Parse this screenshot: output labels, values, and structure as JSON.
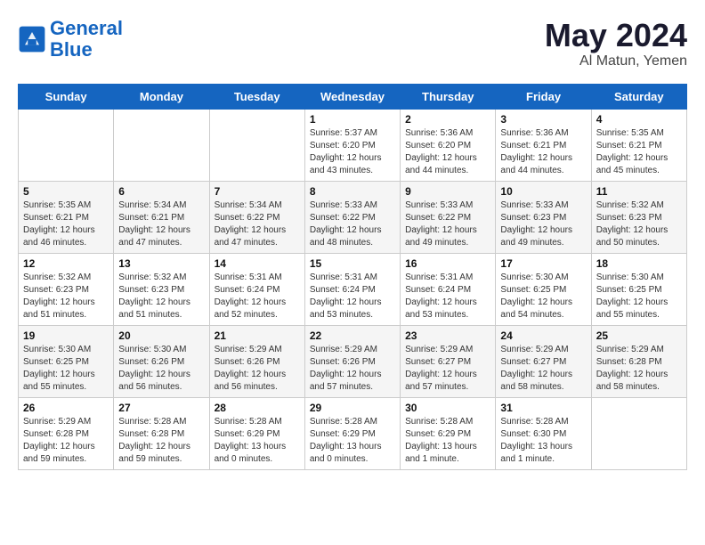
{
  "logo": {
    "line1": "General",
    "line2": "Blue"
  },
  "title": "May 2024",
  "location": "Al Matun, Yemen",
  "days_header": [
    "Sunday",
    "Monday",
    "Tuesday",
    "Wednesday",
    "Thursday",
    "Friday",
    "Saturday"
  ],
  "weeks": [
    [
      {
        "day": "",
        "info": ""
      },
      {
        "day": "",
        "info": ""
      },
      {
        "day": "",
        "info": ""
      },
      {
        "day": "1",
        "info": "Sunrise: 5:37 AM\nSunset: 6:20 PM\nDaylight: 12 hours\nand 43 minutes."
      },
      {
        "day": "2",
        "info": "Sunrise: 5:36 AM\nSunset: 6:20 PM\nDaylight: 12 hours\nand 44 minutes."
      },
      {
        "day": "3",
        "info": "Sunrise: 5:36 AM\nSunset: 6:21 PM\nDaylight: 12 hours\nand 44 minutes."
      },
      {
        "day": "4",
        "info": "Sunrise: 5:35 AM\nSunset: 6:21 PM\nDaylight: 12 hours\nand 45 minutes."
      }
    ],
    [
      {
        "day": "5",
        "info": "Sunrise: 5:35 AM\nSunset: 6:21 PM\nDaylight: 12 hours\nand 46 minutes."
      },
      {
        "day": "6",
        "info": "Sunrise: 5:34 AM\nSunset: 6:21 PM\nDaylight: 12 hours\nand 47 minutes."
      },
      {
        "day": "7",
        "info": "Sunrise: 5:34 AM\nSunset: 6:22 PM\nDaylight: 12 hours\nand 47 minutes."
      },
      {
        "day": "8",
        "info": "Sunrise: 5:33 AM\nSunset: 6:22 PM\nDaylight: 12 hours\nand 48 minutes."
      },
      {
        "day": "9",
        "info": "Sunrise: 5:33 AM\nSunset: 6:22 PM\nDaylight: 12 hours\nand 49 minutes."
      },
      {
        "day": "10",
        "info": "Sunrise: 5:33 AM\nSunset: 6:23 PM\nDaylight: 12 hours\nand 49 minutes."
      },
      {
        "day": "11",
        "info": "Sunrise: 5:32 AM\nSunset: 6:23 PM\nDaylight: 12 hours\nand 50 minutes."
      }
    ],
    [
      {
        "day": "12",
        "info": "Sunrise: 5:32 AM\nSunset: 6:23 PM\nDaylight: 12 hours\nand 51 minutes."
      },
      {
        "day": "13",
        "info": "Sunrise: 5:32 AM\nSunset: 6:23 PM\nDaylight: 12 hours\nand 51 minutes."
      },
      {
        "day": "14",
        "info": "Sunrise: 5:31 AM\nSunset: 6:24 PM\nDaylight: 12 hours\nand 52 minutes."
      },
      {
        "day": "15",
        "info": "Sunrise: 5:31 AM\nSunset: 6:24 PM\nDaylight: 12 hours\nand 53 minutes."
      },
      {
        "day": "16",
        "info": "Sunrise: 5:31 AM\nSunset: 6:24 PM\nDaylight: 12 hours\nand 53 minutes."
      },
      {
        "day": "17",
        "info": "Sunrise: 5:30 AM\nSunset: 6:25 PM\nDaylight: 12 hours\nand 54 minutes."
      },
      {
        "day": "18",
        "info": "Sunrise: 5:30 AM\nSunset: 6:25 PM\nDaylight: 12 hours\nand 55 minutes."
      }
    ],
    [
      {
        "day": "19",
        "info": "Sunrise: 5:30 AM\nSunset: 6:25 PM\nDaylight: 12 hours\nand 55 minutes."
      },
      {
        "day": "20",
        "info": "Sunrise: 5:30 AM\nSunset: 6:26 PM\nDaylight: 12 hours\nand 56 minutes."
      },
      {
        "day": "21",
        "info": "Sunrise: 5:29 AM\nSunset: 6:26 PM\nDaylight: 12 hours\nand 56 minutes."
      },
      {
        "day": "22",
        "info": "Sunrise: 5:29 AM\nSunset: 6:26 PM\nDaylight: 12 hours\nand 57 minutes."
      },
      {
        "day": "23",
        "info": "Sunrise: 5:29 AM\nSunset: 6:27 PM\nDaylight: 12 hours\nand 57 minutes."
      },
      {
        "day": "24",
        "info": "Sunrise: 5:29 AM\nSunset: 6:27 PM\nDaylight: 12 hours\nand 58 minutes."
      },
      {
        "day": "25",
        "info": "Sunrise: 5:29 AM\nSunset: 6:28 PM\nDaylight: 12 hours\nand 58 minutes."
      }
    ],
    [
      {
        "day": "26",
        "info": "Sunrise: 5:29 AM\nSunset: 6:28 PM\nDaylight: 12 hours\nand 59 minutes."
      },
      {
        "day": "27",
        "info": "Sunrise: 5:28 AM\nSunset: 6:28 PM\nDaylight: 12 hours\nand 59 minutes."
      },
      {
        "day": "28",
        "info": "Sunrise: 5:28 AM\nSunset: 6:29 PM\nDaylight: 13 hours\nand 0 minutes."
      },
      {
        "day": "29",
        "info": "Sunrise: 5:28 AM\nSunset: 6:29 PM\nDaylight: 13 hours\nand 0 minutes."
      },
      {
        "day": "30",
        "info": "Sunrise: 5:28 AM\nSunset: 6:29 PM\nDaylight: 13 hours\nand 1 minute."
      },
      {
        "day": "31",
        "info": "Sunrise: 5:28 AM\nSunset: 6:30 PM\nDaylight: 13 hours\nand 1 minute."
      },
      {
        "day": "",
        "info": ""
      }
    ]
  ]
}
